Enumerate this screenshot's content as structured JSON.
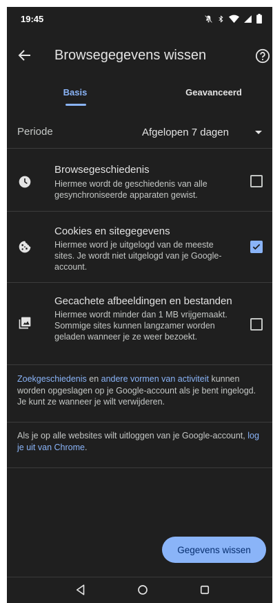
{
  "status": {
    "time": "19:45"
  },
  "app_bar": {
    "title": "Browsegegevens wissen"
  },
  "tabs": [
    {
      "label": "Basis",
      "selected": true
    },
    {
      "label": "Geavanceerd",
      "selected": false
    }
  ],
  "period": {
    "label": "Periode",
    "value": "Afgelopen 7 dagen"
  },
  "options": [
    {
      "icon": "clock-icon",
      "title": "Browsegeschiedenis",
      "description": "Hiermee wordt de geschiedenis van alle gesynchroniseerde apparaten gewist.",
      "checked": false
    },
    {
      "icon": "cookie-icon",
      "title": "Cookies en sitegegevens",
      "description": "Hiermee word je uitgelogd van de meeste sites. Je wordt niet uitgelogd van je Google-account.",
      "checked": true
    },
    {
      "icon": "images-icon",
      "title": "Gecachete afbeeldingen en bestanden",
      "description": "Hiermee wordt minder dan 1 MB vrijgemaakt. Sommige sites kunnen langzamer worden geladen wanneer je ze weer bezoekt.",
      "checked": false
    }
  ],
  "info1": {
    "link1": "Zoekgeschiedenis",
    "text1": " en ",
    "link2": "andere vormen van activiteit",
    "text2": " kunnen worden opgeslagen op je Google-account als je bent ingelogd. Je kunt ze wanneer je wilt verwijderen."
  },
  "info2": {
    "text": "Als je op alle websites wilt uitloggen van je Google-account, ",
    "link": "log je uit van Chrome",
    "end": "."
  },
  "clear_button": {
    "label": "Gegevens wissen"
  },
  "colors": {
    "accent": "#8ab4f8",
    "background": "#1f1f1f",
    "divider": "#3c3c3c"
  }
}
